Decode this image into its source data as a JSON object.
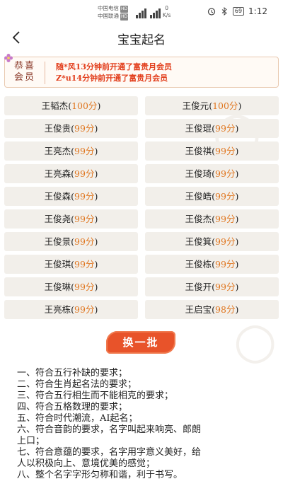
{
  "status_bar": {
    "carrier1": "中国电信",
    "carrier2": "中国联通",
    "hd": "HD",
    "net_type": "4G",
    "speed_value": "0",
    "speed_unit": "K/s",
    "battery": "69",
    "time": "1:12"
  },
  "title_bar": {
    "title": "宝宝起名"
  },
  "notice": {
    "label": "恭喜会员",
    "lines": [
      "随*风13分钟前开通了富贵月会员",
      "Z*u14分钟前开通了富贵月会员"
    ]
  },
  "names": [
    {
      "name": "王韬杰",
      "score": "100分"
    },
    {
      "name": "王俊元",
      "score": "100分"
    },
    {
      "name": "王俊贵",
      "score": "99分"
    },
    {
      "name": "王俊琨",
      "score": "99分"
    },
    {
      "name": "王亮杰",
      "score": "99分"
    },
    {
      "name": "王俊祺",
      "score": "99分"
    },
    {
      "name": "王亮森",
      "score": "99分"
    },
    {
      "name": "王俊琦",
      "score": "99分"
    },
    {
      "name": "王俊森",
      "score": "99分"
    },
    {
      "name": "王俊皓",
      "score": "99分"
    },
    {
      "name": "王俊尧",
      "score": "99分"
    },
    {
      "name": "王俊杰",
      "score": "99分"
    },
    {
      "name": "王俊景",
      "score": "99分"
    },
    {
      "name": "王俊箕",
      "score": "99分"
    },
    {
      "name": "王俊琪",
      "score": "99分"
    },
    {
      "name": "王俊栋",
      "score": "99分"
    },
    {
      "name": "王俊琳",
      "score": "99分"
    },
    {
      "name": "王俊开",
      "score": "99分"
    },
    {
      "name": "王亮栋",
      "score": "99分"
    },
    {
      "name": "王启宝",
      "score": "98分"
    }
  ],
  "refresh_label": "换一批",
  "rules": [
    "一、符合五行补缺的要求；",
    "二、符合生肖起名法的要求；",
    "三、符合五行相生而不能相克的要求；",
    "四、符合五格数理的要求；",
    "五、符合时代潮流，AI起名；",
    "六、符合音韵的要求，名字叫起来响亮、郎朗",
    "上口；",
    "七、符合意蕴的要求，名字用字意义美好，给",
    "人以积极向上、意境优美的感觉；",
    "八、整个名字字形匀称和谐，利于书写。"
  ],
  "colors": {
    "accent": "#e8532a",
    "score": "#e0761f",
    "notice_text": "#e23e1c",
    "cell_bg": "#f2efea"
  }
}
